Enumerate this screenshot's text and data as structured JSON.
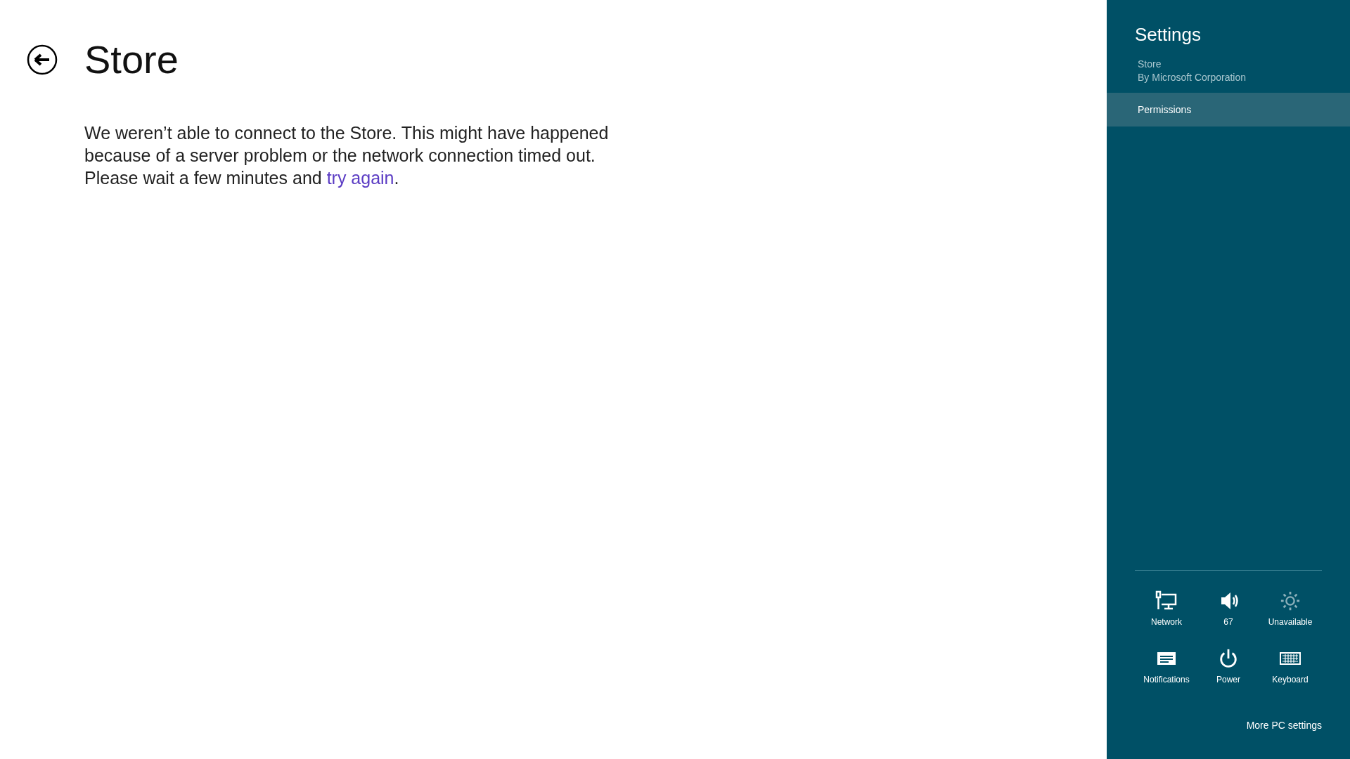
{
  "page": {
    "title": "Store",
    "message": {
      "before": "We weren’t able to connect to the Store. This might have happened because of a server problem or the network connection timed out. Please wait a few minutes and ",
      "link": "try again",
      "after": "."
    }
  },
  "settings_pane": {
    "title": "Settings",
    "app_name": "Store",
    "publisher": "By Microsoft Corporation",
    "items": [
      {
        "label": "Permissions",
        "selected": true
      }
    ],
    "quick_settings": [
      {
        "kind": "network",
        "label": "Network",
        "disabled": false
      },
      {
        "kind": "volume",
        "label": "67",
        "disabled": false
      },
      {
        "kind": "brightness",
        "label": "Unavailable",
        "disabled": true
      },
      {
        "kind": "notifications",
        "label": "Notifications",
        "disabled": false
      },
      {
        "kind": "power",
        "label": "Power",
        "disabled": false
      },
      {
        "kind": "keyboard",
        "label": "Keyboard",
        "disabled": false
      }
    ],
    "more_link": "More PC settings"
  }
}
